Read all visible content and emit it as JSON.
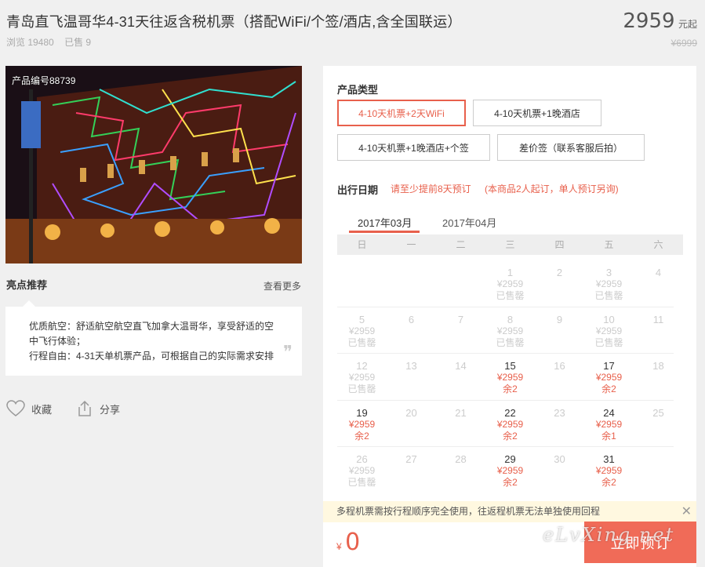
{
  "header": {
    "title": "青岛直飞温哥华4-31天往返含税机票（搭配WiFi/个签/酒店,含全国联运）",
    "views": "浏览 19480",
    "sold": "已售 9",
    "price": "2959",
    "price_unit": "元起",
    "old_price": "¥6999"
  },
  "photo": {
    "product_no": "产品编号88739"
  },
  "highlights": {
    "title": "亮点推荐",
    "more": "查看更多",
    "line1": "优质航空：舒适航空航空直飞加拿大温哥华，享受舒适的空中飞行体验；",
    "line2": "行程自由：4-31天单机票产品，可根据自己的实际需求安排",
    "quote": "❞"
  },
  "actions": {
    "favorite": "收藏",
    "share": "分享"
  },
  "product": {
    "type_label": "产品类型",
    "options": [
      "4-10天机票+2天WiFi",
      "4-10天机票+1晚酒店",
      "4-10天机票+1晚酒店+个签",
      "差价签（联系客服后拍）"
    ],
    "selected": 0
  },
  "date": {
    "label": "出行日期",
    "note1": "请至少提前8天预订",
    "note2": "(本商品2人起订，单人预订另询)"
  },
  "calendar": {
    "months": [
      "2017年03月",
      "2017年04月"
    ],
    "active_month": 0,
    "weekdays": [
      "日",
      "一",
      "二",
      "三",
      "四",
      "五",
      "六"
    ],
    "cells": [
      {
        "d": "",
        "p": "",
        "s": "",
        "on": false
      },
      {
        "d": "",
        "p": "",
        "s": "",
        "on": false
      },
      {
        "d": "",
        "p": "",
        "s": "",
        "on": false
      },
      {
        "d": "1",
        "p": "¥2959",
        "s": "已售罄",
        "on": false
      },
      {
        "d": "2",
        "p": "",
        "s": "",
        "on": false
      },
      {
        "d": "3",
        "p": "¥2959",
        "s": "已售罄",
        "on": false
      },
      {
        "d": "4",
        "p": "",
        "s": "",
        "on": false
      },
      {
        "d": "5",
        "p": "¥2959",
        "s": "已售罄",
        "on": false
      },
      {
        "d": "6",
        "p": "",
        "s": "",
        "on": false
      },
      {
        "d": "7",
        "p": "",
        "s": "",
        "on": false
      },
      {
        "d": "8",
        "p": "¥2959",
        "s": "已售罄",
        "on": false
      },
      {
        "d": "9",
        "p": "",
        "s": "",
        "on": false
      },
      {
        "d": "10",
        "p": "¥2959",
        "s": "已售罄",
        "on": false
      },
      {
        "d": "11",
        "p": "",
        "s": "",
        "on": false
      },
      {
        "d": "12",
        "p": "¥2959",
        "s": "已售罄",
        "on": false
      },
      {
        "d": "13",
        "p": "",
        "s": "",
        "on": false
      },
      {
        "d": "14",
        "p": "",
        "s": "",
        "on": false
      },
      {
        "d": "15",
        "p": "¥2959",
        "s": "余2",
        "on": true
      },
      {
        "d": "16",
        "p": "",
        "s": "",
        "on": false
      },
      {
        "d": "17",
        "p": "¥2959",
        "s": "余2",
        "on": true
      },
      {
        "d": "18",
        "p": "",
        "s": "",
        "on": false
      },
      {
        "d": "19",
        "p": "¥2959",
        "s": "余2",
        "on": true
      },
      {
        "d": "20",
        "p": "",
        "s": "",
        "on": false
      },
      {
        "d": "21",
        "p": "",
        "s": "",
        "on": false
      },
      {
        "d": "22",
        "p": "¥2959",
        "s": "余2",
        "on": true
      },
      {
        "d": "23",
        "p": "",
        "s": "",
        "on": false
      },
      {
        "d": "24",
        "p": "¥2959",
        "s": "余1",
        "on": true
      },
      {
        "d": "25",
        "p": "",
        "s": "",
        "on": false
      },
      {
        "d": "26",
        "p": "¥2959",
        "s": "已售罄",
        "on": false
      },
      {
        "d": "27",
        "p": "",
        "s": "",
        "on": false
      },
      {
        "d": "28",
        "p": "",
        "s": "",
        "on": false
      },
      {
        "d": "29",
        "p": "¥2959",
        "s": "余2",
        "on": true
      },
      {
        "d": "30",
        "p": "",
        "s": "",
        "on": false
      },
      {
        "d": "31",
        "p": "¥2959",
        "s": "余2",
        "on": true
      },
      {
        "d": "",
        "p": "",
        "s": "",
        "on": false
      }
    ]
  },
  "notice": {
    "text": "多程机票需按行程顺序完全使用，往返程机票无法单独使用回程",
    "close": "✕"
  },
  "footer": {
    "currency": "¥",
    "total": "0",
    "book": "立即预订",
    "watermark": "eLvXing.net"
  },
  "colors": {
    "accent": "#e8604c",
    "book_bg": "#f06b58",
    "page_bg": "#f0f0f0"
  },
  "icons": {
    "favorite": "heart-icon",
    "share": "share-icon"
  }
}
